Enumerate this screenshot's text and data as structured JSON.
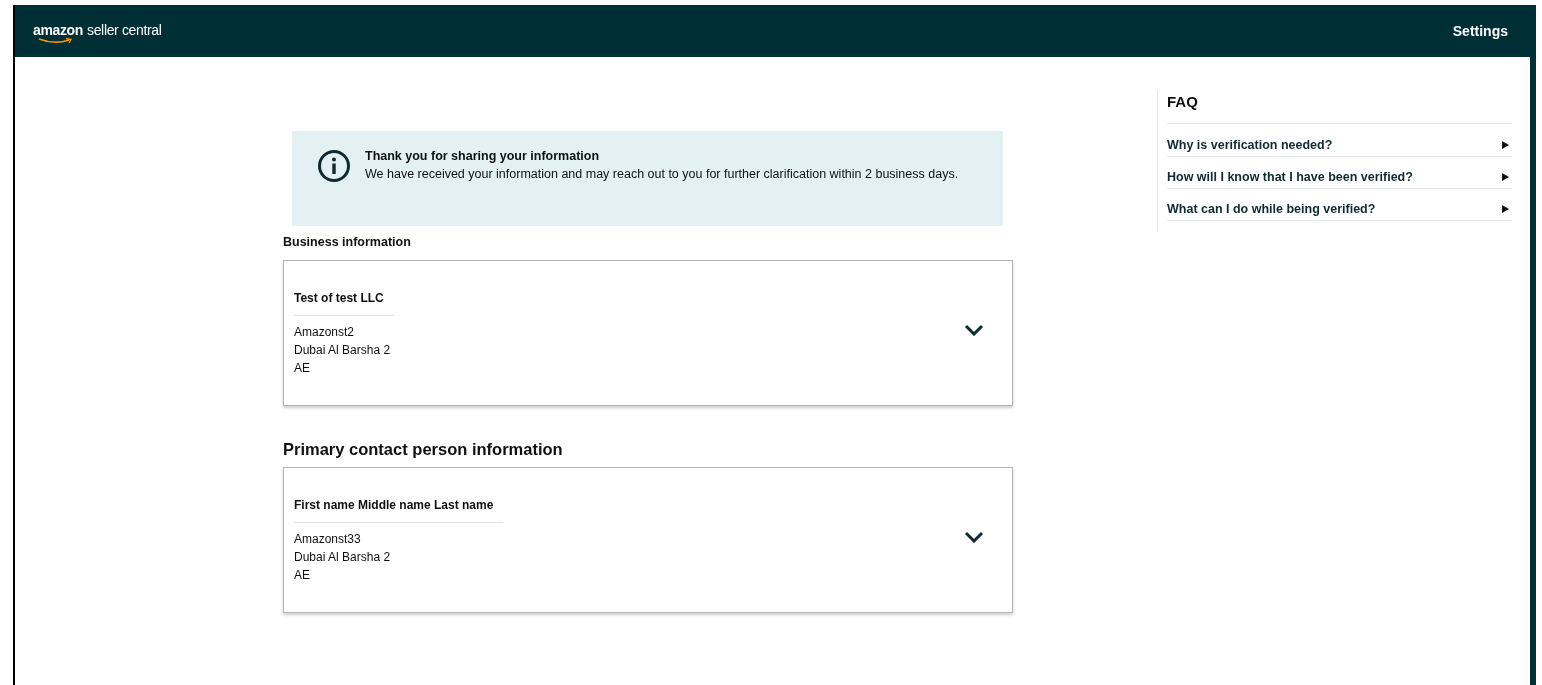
{
  "header": {
    "logo_brand": "amazon",
    "logo_product": "seller central",
    "settings": "Settings"
  },
  "notice": {
    "title": "Thank you for sharing your information",
    "message": "We have received your information and may reach out to you for further clarification within 2 business days."
  },
  "sections": [
    {
      "heading": "Business information",
      "card": {
        "name": "Test of test LLC",
        "lines": [
          "Amazonst2",
          "Dubai Al Barsha 2",
          "AE"
        ],
        "expanded": false
      }
    },
    {
      "heading": "Primary contact person information",
      "card": {
        "name": "First name Middle name Last name",
        "lines": [
          "Amazonst33",
          "Dubai Al Barsha 2",
          "AE"
        ],
        "expanded": false
      }
    }
  ],
  "faq": {
    "title": "FAQ",
    "items": [
      {
        "question": "Why is verification needed?",
        "expanded": false
      },
      {
        "question": "How will I know that I have been verified?",
        "expanded": false
      },
      {
        "question": "What can I do while being verified?",
        "expanded": false
      }
    ]
  }
}
